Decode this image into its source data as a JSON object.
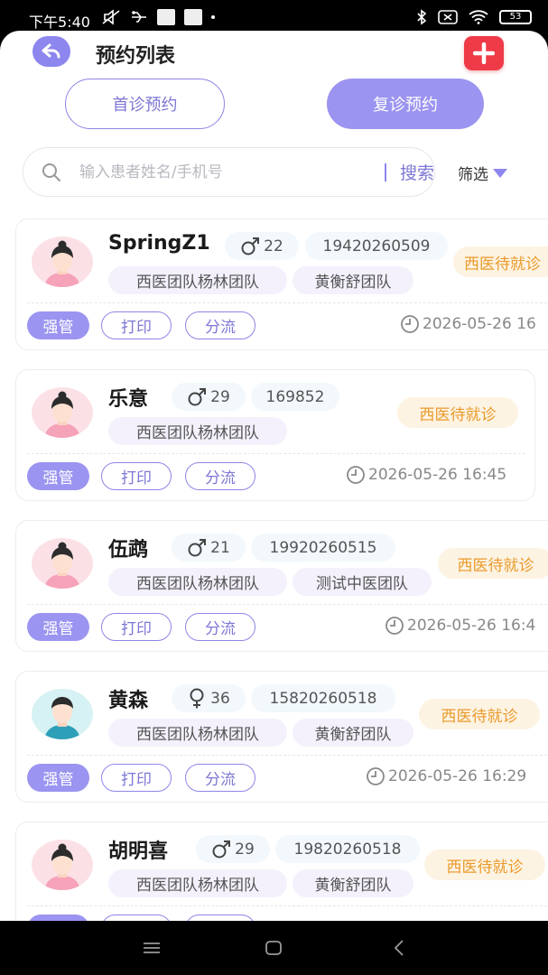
{
  "status_bar": {
    "time": "下午5:40",
    "battery": "53"
  },
  "header": {
    "title": "预约列表"
  },
  "tabs": [
    {
      "label": "首诊预约",
      "active": false
    },
    {
      "label": "复诊预约",
      "active": true
    }
  ],
  "search": {
    "placeholder": "输入患者姓名/手机号",
    "button": "搜索"
  },
  "filter": {
    "label": "筛选"
  },
  "actions": {
    "strong": "强管",
    "print": "打印",
    "triage": "分流"
  },
  "patients": [
    {
      "name": "SpringZ1",
      "gender": "male",
      "age": "22",
      "phone": "19420260509",
      "teams": [
        "西医团队杨林团队",
        "黄衡舒团队"
      ],
      "status": "西医待就诊",
      "time": "2026-05-26 16",
      "avatar": "female"
    },
    {
      "name": "乐意",
      "gender": "male",
      "age": "29",
      "phone": "169852",
      "teams": [
        "西医团队杨林团队"
      ],
      "status": "西医待就诊",
      "time": "2026-05-26 16:45",
      "avatar": "female"
    },
    {
      "name": "伍鹉",
      "gender": "male",
      "age": "21",
      "phone": "19920260515",
      "teams": [
        "西医团队杨林团队",
        "测试中医团队"
      ],
      "status": "西医待就诊",
      "time": "2026-05-26 16:4",
      "avatar": "female"
    },
    {
      "name": "黄森",
      "gender": "female",
      "age": "36",
      "phone": "15820260518",
      "teams": [
        "西医团队杨林团队",
        "黄衡舒团队"
      ],
      "status": "西医待就诊",
      "time": "2026-05-26 16:29",
      "avatar": "male"
    },
    {
      "name": "胡明喜",
      "gender": "male",
      "age": "29",
      "phone": "19820260518",
      "teams": [
        "西医团队杨林团队",
        "黄衡舒团队"
      ],
      "status": "西医待就诊",
      "time": "",
      "avatar": "female"
    }
  ],
  "colors": {
    "primary": "#9b94f0",
    "primary_text": "#7d77d4",
    "status_orange": "#ea9a2a",
    "add_red": "#ef3b48"
  }
}
